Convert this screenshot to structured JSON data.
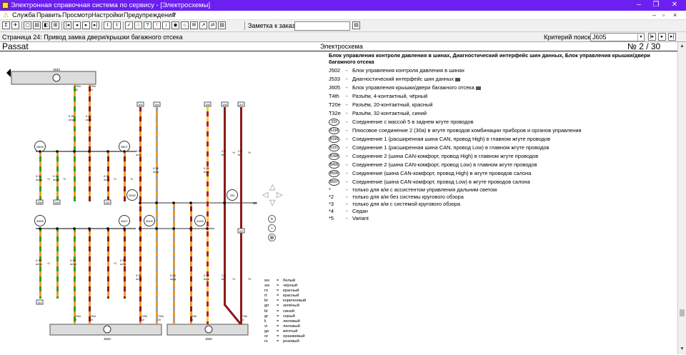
{
  "window": {
    "title": "Электронная справочная система по сервису - [Электросхемы]",
    "controls": [
      "–",
      "❐",
      "✕"
    ]
  },
  "menu": {
    "items": [
      "Служба",
      "Править",
      "Просмотр",
      "Настройки",
      "Предупреждения",
      "?"
    ],
    "mdi_controls": [
      "–",
      "▫",
      "×"
    ]
  },
  "toolbar": {
    "buttons_left": [
      "Σ",
      "✈",
      "▢",
      "▤",
      "◧",
      "⊞",
      "|◂",
      "◂",
      "▸",
      "▸|",
      "t",
      "t",
      "✓",
      "⚠",
      "?",
      "!",
      "↕",
      "◉",
      "⌂",
      "✉",
      "↗",
      "⇄",
      "▤"
    ],
    "note_label": "Заметка к заказу:",
    "note_value": "",
    "note_button": "▤"
  },
  "info": {
    "page_label": "Страница 24: Привод замка двери/крышки багажного отсека",
    "criteria_label": "Критерий поиска:",
    "criteria_value": "J605",
    "criteria_dropdown": "▾",
    "nav_buttons": [
      "|▸",
      "▸",
      "▸|"
    ]
  },
  "header": {
    "model": "Passat",
    "doc_type": "Электросхема",
    "page_no": "№  2 / 30"
  },
  "legend": {
    "title": "Блок управления контроля давления в шинах, Диагностический интерфейс шин данных, Блок управления крышки/двери багажного отсека",
    "rows": [
      {
        "code": "J502",
        "text": "Блок управления контроля давления в шинах",
        "cam": false
      },
      {
        "code": "J533",
        "text": "Диагностический интерфейс шин данных",
        "cam": true
      },
      {
        "code": "J605",
        "text": "Блок управления крышки/двери багажного отсека",
        "cam": true
      },
      {
        "code": "T4th",
        "text": "Разъём, 4-контактный, чёрный",
        "cam": false
      },
      {
        "code": "T20e",
        "text": "Разъём, 20-контактный, красный",
        "cam": false
      },
      {
        "code": "T32e",
        "text": "Разъём, 32-контактный, синий",
        "cam": false
      }
    ],
    "circle_rows": [
      {
        "code": "333",
        "text": "Соединение с массой 5 в заднем жгуте проводов"
      },
      {
        "code": "A194",
        "text": "Плюсовое соединение 2 (30а) в жгуте проводов комбинации приборов и органов управления"
      },
      {
        "code": "B190",
        "text": "Соединение 1 (расширенная шина CAN, провод High) в главном жгуте проводов"
      },
      {
        "code": "B191",
        "text": "Соединение 1 (расширенная шина CAN, провод Low) в главном жгуте проводов"
      },
      {
        "code": "B398",
        "text": "Соединение 2 (шина CAN-комфорт, провод High) в главном жгуте проводов"
      },
      {
        "code": "B406",
        "text": "Соединение 2 (шина CAN-комфорт, провод Low) в главном жгуте проводов"
      },
      {
        "code": "B506",
        "text": "Соединение (шина CAN-комфорт, провод High) в жгуте проводов салона"
      },
      {
        "code": "B507",
        "text": "Соединение (шина CAN-комфорт, провод Low) в жгуте проводов салона"
      }
    ],
    "notes": [
      {
        "mark": "*",
        "text": "только для а/м с ассистентом управления дальним светом"
      },
      {
        "mark": "*2",
        "text": "только для а/м без системы кругового обзора"
      },
      {
        "mark": "*3",
        "text": "только для а/м с системой кругового обзора"
      },
      {
        "mark": "*4",
        "text": "Седан"
      },
      {
        "mark": "*5",
        "text": "Variant"
      }
    ]
  },
  "colors": {
    "title_bar": "#6b1ff0",
    "wire_orange": "#f29a1f",
    "wire_green": "#2e9e2e",
    "wire_red": "#c8102e",
    "wire_grey": "#9aa0a6",
    "wire_brown": "#8b1a1a",
    "component_fill": "#dcdcdc",
    "list": [
      {
        "code": "ws",
        "name": "белый"
      },
      {
        "code": "sw",
        "name": "чёрный"
      },
      {
        "code": "ro",
        "name": "красный"
      },
      {
        "code": "rt",
        "name": "красный"
      },
      {
        "code": "br",
        "name": "коричневый"
      },
      {
        "code": "gn",
        "name": "зелёный"
      },
      {
        "code": "bl",
        "name": "синий"
      },
      {
        "code": "gr",
        "name": "серый"
      },
      {
        "code": "li",
        "name": "лиловый"
      },
      {
        "code": "vi",
        "name": "лиловый"
      },
      {
        "code": "ge",
        "name": "жёлтый"
      },
      {
        "code": "or",
        "name": "оранжевый"
      },
      {
        "code": "rs",
        "name": "розовый"
      }
    ]
  },
  "diagram": {
    "components": {
      "top": "J533",
      "bottom_left": "J533",
      "bottom_right": "J502",
      "tail": "30"
    },
    "splices": [
      {
        "id": "splice_b506",
        "label": "B506"
      },
      {
        "id": "splice_b507",
        "label": "B507"
      },
      {
        "id": "splice_b398",
        "label": "B398"
      },
      {
        "id": "splice_b407",
        "label": "B407"
      },
      {
        "id": "splice_b190",
        "label": "B190"
      },
      {
        "id": "splice_b108",
        "label": "B108"
      },
      {
        "id": "splice_a194",
        "label": "A194"
      },
      {
        "id": "splice_333",
        "label": "333"
      }
    ],
    "wires": [
      {
        "label": "0.35\nor/gn",
        "color": "or/gn"
      },
      {
        "label": "0.35\nor/br",
        "color": "or/br"
      },
      {
        "label": "0.35\nor/gr",
        "color": "or/gr"
      },
      {
        "label": "0.35\nrt/ge",
        "color": "rt/ge"
      },
      {
        "label": "2.5\nbr",
        "color": "br"
      }
    ],
    "connectors_top": [
      "T32e\n32",
      "T32e\n31"
    ],
    "connectors_bottom": [
      "T20e\n9",
      "T20e\n19",
      "T20e\n10",
      "T20e\n20",
      "T4th\n3",
      "T4th\n4"
    ],
    "ref_boxes": [
      "203",
      "204",
      "205",
      "206",
      "207",
      "208",
      "209",
      "210",
      "211",
      "212"
    ],
    "notes": [
      "*2",
      "*3",
      "*4",
      "*5"
    ],
    "nav_controls": [
      "◁",
      "▷",
      "△",
      "▽"
    ],
    "zoom_controls": [
      "+",
      "−",
      "⊕"
    ]
  }
}
